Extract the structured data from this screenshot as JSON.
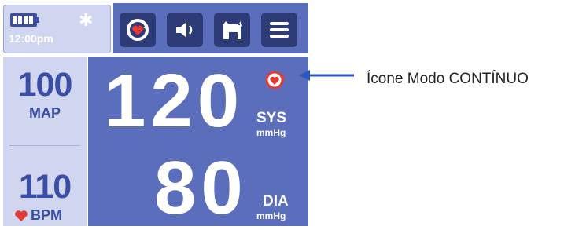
{
  "status": {
    "time": "12:00pm",
    "battery_icon": "battery-full-icon",
    "bluetooth_icon": "bluetooth-icon"
  },
  "toolbar": {
    "buttons": [
      {
        "name": "continuous-mode-button",
        "icon": "heart-cycle-icon"
      },
      {
        "name": "volume-button",
        "icon": "speaker-icon"
      },
      {
        "name": "patient-type-button",
        "icon": "dog-icon"
      },
      {
        "name": "menu-button",
        "icon": "hamburger-menu-icon"
      }
    ]
  },
  "vitals": {
    "map_value": "100",
    "map_label": "MAP",
    "pulse_value": "110",
    "pulse_label": "BPM",
    "sys_value": "120",
    "sys_label": "SYS",
    "sys_unit": "mmHg",
    "dia_value": "80",
    "dia_label": "DIA",
    "dia_unit": "mmHg"
  },
  "callout": {
    "text": "Ícone Modo CONTÍNUO"
  },
  "colors": {
    "panel_blue": "#5b6ebb",
    "light_panel": "#d0d6f0",
    "button_dark": "#2d3b77",
    "heart_red": "#e53935",
    "arrow_blue": "#2f57b8"
  }
}
